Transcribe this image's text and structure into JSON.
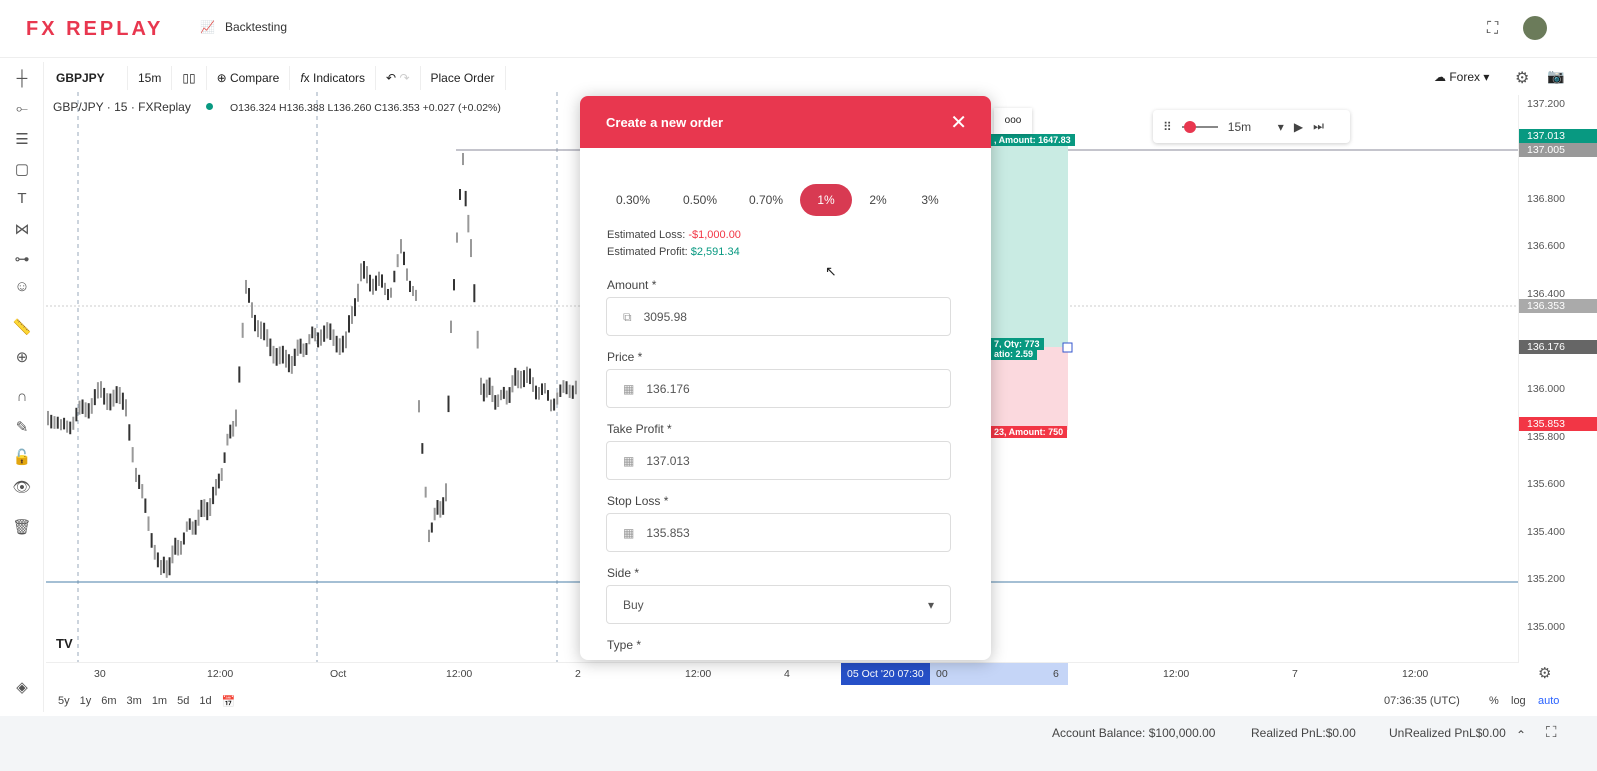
{
  "header": {
    "logo": "FX REPLAY",
    "nav_label": "Backtesting"
  },
  "toolbar": {
    "symbol": "GBPJPY",
    "interval": "15m",
    "compare": "Compare",
    "indicators": "Indicators",
    "place_order": "Place Order",
    "market": "Forex"
  },
  "legend": {
    "title": "GBP/JPY · 15 · FXReplay",
    "ohlc": "O136.324 H136.388 L136.260 C136.353 +0.027 (+0.02%)"
  },
  "price_axis": {
    "labels": [
      "137.200",
      "136.800",
      "136.600",
      "136.400",
      "136.000",
      "135.800",
      "135.600",
      "135.400",
      "135.200",
      "135.000"
    ],
    "tp": "137.013",
    "high": "137.005",
    "current": "136.353",
    "entry": "136.176",
    "sl": "135.853"
  },
  "time_axis": {
    "labels": [
      "30",
      "12:00",
      "Oct",
      "12:00",
      "2",
      "12:00",
      "4",
      "00",
      "6",
      "12:00",
      "7",
      "12:00"
    ],
    "cursor": "05 Oct '20  07:30"
  },
  "position_tags": {
    "tp": ", Amount: 1647.83",
    "entry1": "7, Qty: 773",
    "entry2": "atio: 2.59",
    "sl": "23, Amount: 750"
  },
  "replay": {
    "interval": "15m"
  },
  "ranges": [
    "5y",
    "1y",
    "6m",
    "3m",
    "1m",
    "5d",
    "1d"
  ],
  "bottom": {
    "clock": "07:36:35 (UTC)",
    "pct": "%",
    "log": "log",
    "auto": "auto"
  },
  "status": {
    "balance": "Account Balance: $100,000.00",
    "realized": "Realized PnL:$0.00",
    "unrealized": "UnRealized PnL$0.00"
  },
  "modal": {
    "title": "Create a new order",
    "risk_options": [
      "0.30%",
      "0.50%",
      "0.70%",
      "1%",
      "2%",
      "3%"
    ],
    "selected_risk": "1%",
    "est_loss_label": "Estimated Loss:",
    "est_loss": "-$1,000.00",
    "est_profit_label": "Estimated Profit:",
    "est_profit": "$2,591.34",
    "amount_label": "Amount *",
    "amount": "3095.98",
    "price_label": "Price *",
    "price": "136.176",
    "tp_label": "Take Profit *",
    "tp": "137.013",
    "sl_label": "Stop Loss *",
    "sl": "135.853",
    "side_label": "Side *",
    "side": "Buy",
    "type_label": "Type *"
  },
  "colors": {
    "accent": "#e8374f",
    "profit": "#089981",
    "loss": "#f23645"
  }
}
